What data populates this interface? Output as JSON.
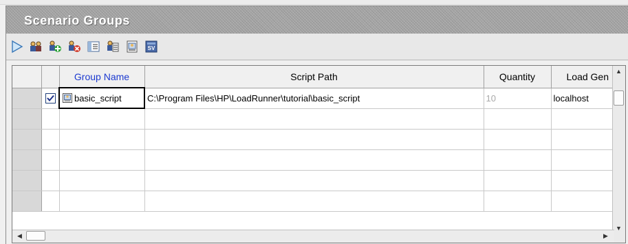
{
  "panel": {
    "title": "Scenario Groups"
  },
  "toolbar": {
    "buttons": [
      {
        "name": "play-icon"
      },
      {
        "name": "users-icon"
      },
      {
        "name": "add-group-icon"
      },
      {
        "name": "remove-group-icon"
      },
      {
        "name": "details-icon"
      },
      {
        "name": "view-script-icon"
      },
      {
        "name": "script-icon"
      },
      {
        "name": "sv-icon"
      }
    ]
  },
  "grid": {
    "columns": [
      "Group Name",
      "Script Path",
      "Quantity",
      "Load Gen"
    ],
    "rows": [
      {
        "checked": true,
        "group_name": "basic_script",
        "script_path": "C:\\Program Files\\HP\\LoadRunner\\tutorial\\basic_script",
        "quantity": "10",
        "load_gen": "localhost"
      }
    ],
    "empty_rows": 5
  },
  "colors": {
    "header_link": "#1c3ad0",
    "title_bar": "#a7a7a7"
  }
}
